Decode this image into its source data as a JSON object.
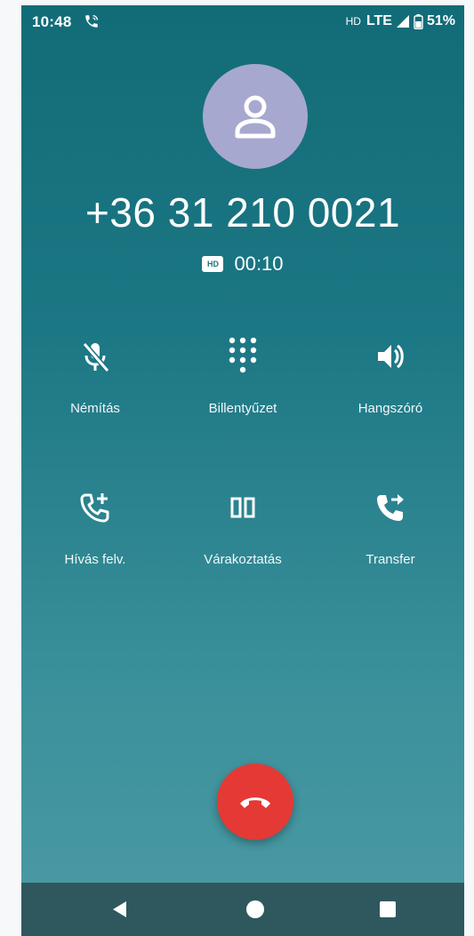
{
  "status_bar": {
    "time": "10:48",
    "hd": "HD",
    "network": "LTE",
    "battery": "51%"
  },
  "call": {
    "number": "+36 31 210 0021",
    "hd_badge": "HD",
    "duration": "00:10"
  },
  "buttons": {
    "mute": "Némítás",
    "keypad": "Billentyűzet",
    "speaker": "Hangszóró",
    "add_call": "Hívás felv.",
    "hold": "Várakoztatás",
    "transfer": "Transfer"
  },
  "colors": {
    "background_top": "#126c78",
    "background_bottom": "#4b9aa4",
    "avatar": "#a7a8cf",
    "end_call": "#e53935",
    "nav_bar": "#2e585e"
  },
  "icons": {
    "mute": "mic-off-icon",
    "keypad": "dialpad-icon",
    "speaker": "speaker-icon",
    "add_call": "add-call-icon",
    "hold": "pause-icon",
    "transfer": "call-transfer-icon",
    "end_call": "end-call-icon"
  }
}
